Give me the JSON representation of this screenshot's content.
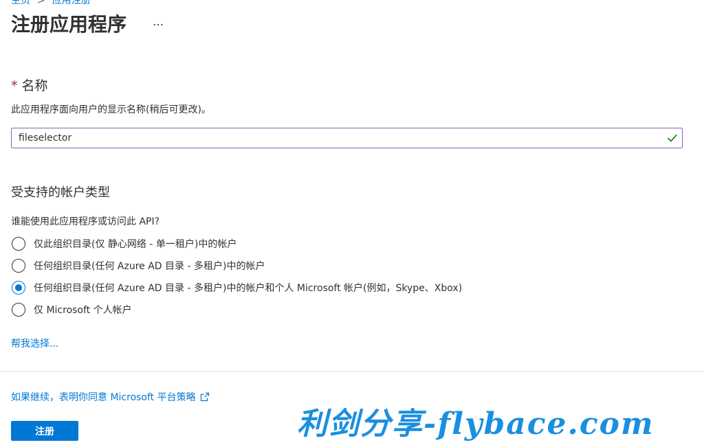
{
  "breadcrumb": {
    "items": [
      "主页",
      "应用注册"
    ]
  },
  "page": {
    "title": "注册应用程序",
    "more_menu": "…"
  },
  "name_field": {
    "required_marker": "*",
    "label": "名称",
    "description": "此应用程序面向用户的显示名称(稍后可更改)。",
    "value": "fileselector",
    "valid_icon": "checkmark-icon"
  },
  "account_types": {
    "title": "受支持的帐户类型",
    "question": "谁能使用此应用程序或访问此 API?",
    "selected_index": 2,
    "options": [
      "仅此组织目录(仅 静心网络 - 单一租户)中的帐户",
      "任何组织目录(任何 Azure AD 目录 - 多租户)中的帐户",
      "任何组织目录(任何 Azure AD 目录 - 多租户)中的帐户和个人 Microsoft 帐户(例如，Skype、Xbox)",
      "仅 Microsoft 个人帐户"
    ],
    "help_link": "帮我选择..."
  },
  "footer": {
    "policy_link": "如果继续，表明你同意 Microsoft 平台策略",
    "register_label": "注册"
  },
  "watermark": {
    "text": "利剑分享-flybace.com"
  },
  "colors": {
    "accent": "#0078d4",
    "input_border": "#8764b8",
    "valid_check": "#107c10",
    "required": "#a4262c",
    "watermark": "#1a8fe0"
  }
}
